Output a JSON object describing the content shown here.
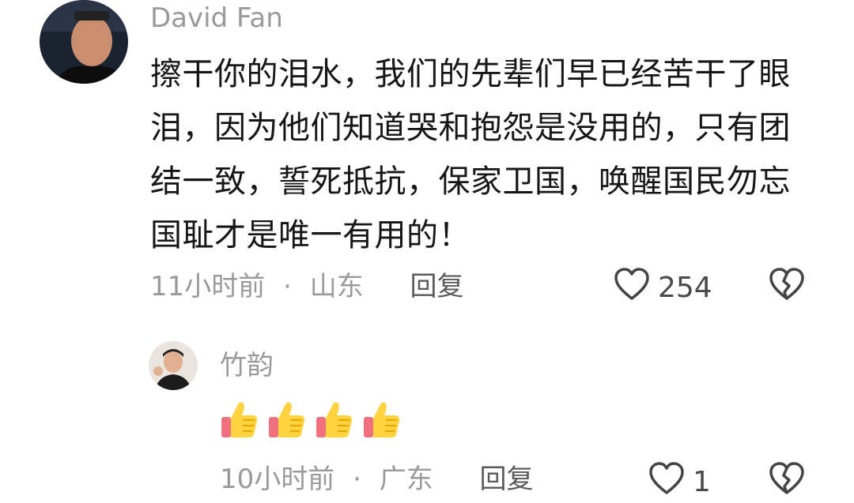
{
  "comments": [
    {
      "author": "David Fan",
      "text": "擦干你的泪水，我们的先辈们早已经苦干了眼泪，因为他们知道哭和抱怨是没用的，只有团结一致，誓死抵抗，保家卫国，唤醒国民勿忘国耻才是唯一有用的！",
      "time": "11小时前",
      "location": "山东",
      "reply_label": "回复",
      "likes": "254"
    },
    {
      "author": "竹韵",
      "text": "",
      "emoji_count": 4,
      "time": "10小时前",
      "location": "广东",
      "reply_label": "回复",
      "likes": "1"
    }
  ],
  "separator": "·",
  "icons": {
    "like": "heart-outline-icon",
    "dislike": "broken-heart-icon",
    "emoji": "thumbs-up-emoji"
  }
}
